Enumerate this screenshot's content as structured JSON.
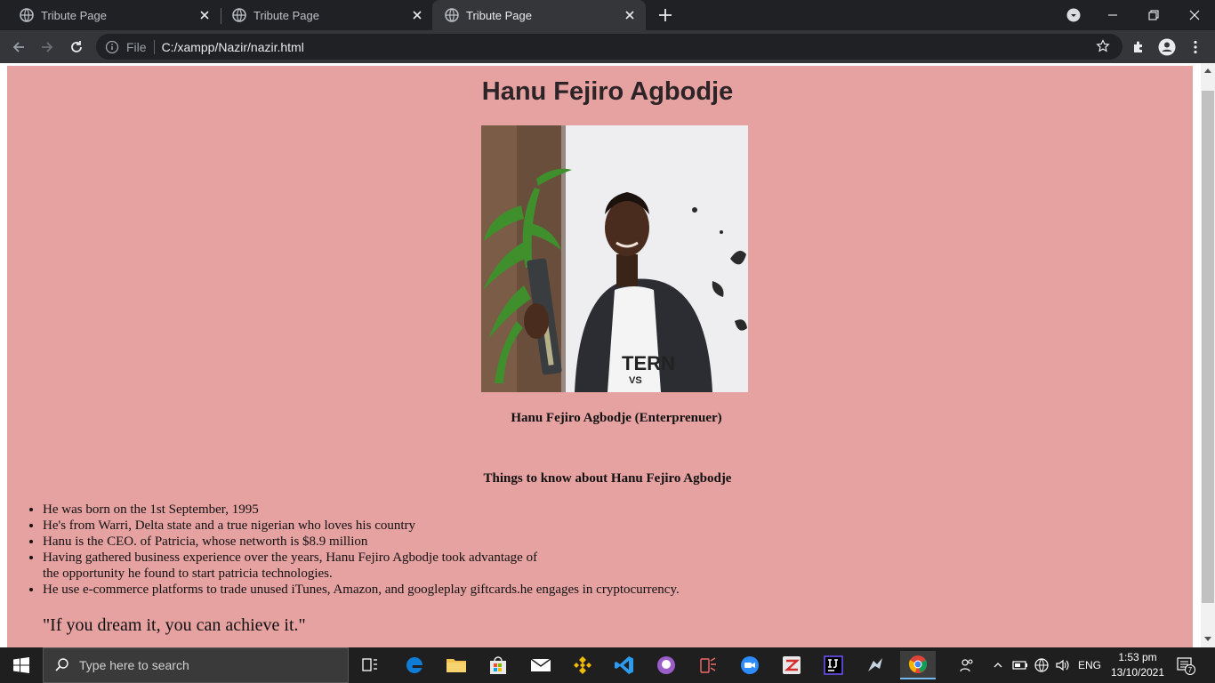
{
  "browser": {
    "tabs": [
      {
        "title": "Tribute Page",
        "active": false
      },
      {
        "title": "Tribute Page",
        "active": false
      },
      {
        "title": "Tribute Page",
        "active": true
      }
    ],
    "address": {
      "scheme_label": "File",
      "url": "C:/xampp/Nazir/nazir.html"
    }
  },
  "page": {
    "heading": "Hanu Fejiro Agbodje",
    "image_alt": "Hanu Fejiro Agbodje holding an award",
    "caption": "Hanu Fejiro Agbodje (Enterprenuer)",
    "section_title": "Things to know about Hanu Fejiro Agbodje",
    "facts": [
      "He was born on the 1st September, 1995",
      "He's from Warri, Delta state and a true nigerian who loves his country",
      "Hanu is the CEO. of Patricia, whose networth is $8.9 million",
      "Having gathered business experience over the years, Hanu Fejiro Agbodje took advantage of",
      "the opportunity he found to start patricia technologies.",
      "He use e-commerce platforms to trade unused iTunes, Amazon, and googleplay giftcards.he engages in cryptocurrency."
    ],
    "quote": "\"If you dream it, you can achieve it.\"",
    "background_color": "#e6a1a1"
  },
  "taskbar": {
    "search_placeholder": "Type here to search",
    "lang": "ENG",
    "time": "1:53 pm",
    "date": "13/10/2021",
    "notifications": "7"
  }
}
